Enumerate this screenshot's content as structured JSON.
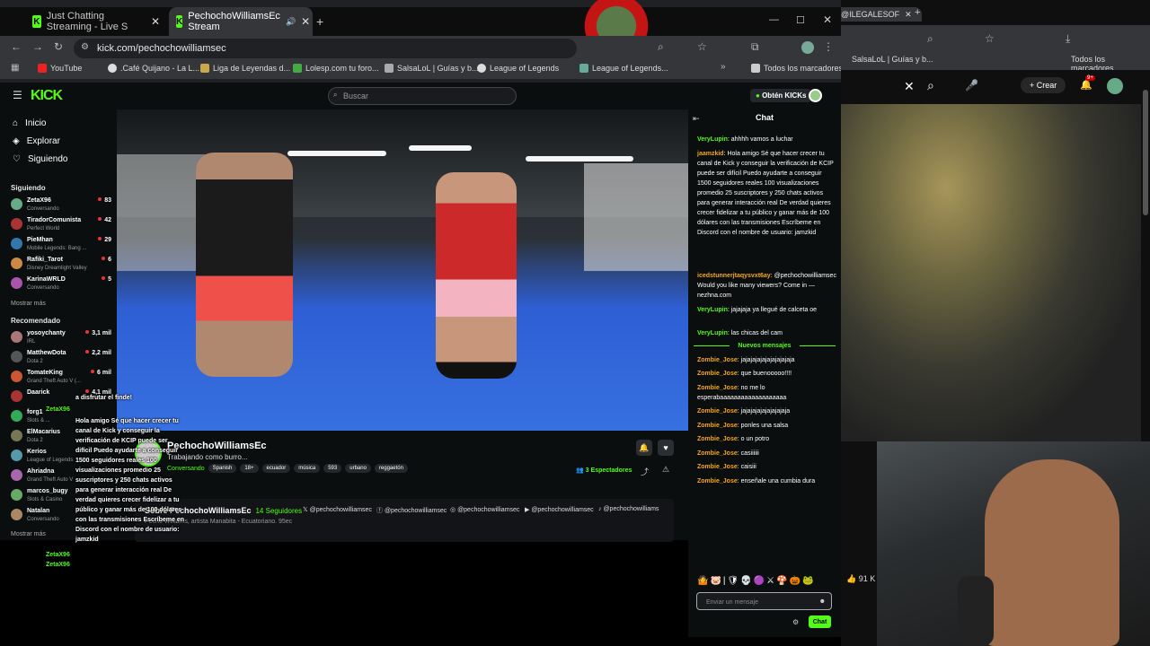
{
  "browser": {
    "tabs": [
      {
        "title": "Just Chatting Streaming - Live S"
      },
      {
        "title": "PechochoWilliamsEc Stream"
      }
    ],
    "url": "kick.com/pechochowilliamsec",
    "bookmarks": [
      "YouTube",
      ".Café Quijano - La L...",
      "Liga de Leyendas d...",
      "Lolesp.com tu foro...",
      "SalsaLoL | Guías y b...",
      "League of Legends",
      "League of Legends..."
    ],
    "all_bookmarks": "Todos los marcadores"
  },
  "header": {
    "logo": "KICK",
    "search_placeholder": "Buscar",
    "get_kicks": "Obtén KICKs"
  },
  "sidebar": {
    "nav": [
      {
        "label": "Inicio",
        "icon": "home-icon"
      },
      {
        "label": "Explorar",
        "icon": "compass-icon"
      },
      {
        "label": "Siguiendo",
        "icon": "heart-icon"
      }
    ],
    "following_title": "Siguiendo",
    "following": [
      {
        "name": "ZetaX96",
        "category": "Conversando",
        "viewers": "83",
        "color": "#6a8"
      },
      {
        "name": "TiradorComunista",
        "category": "Perfect World",
        "viewers": "42",
        "color": "#a33"
      },
      {
        "name": "PieMhan",
        "category": "Mobile Legends: Bang ...",
        "viewers": "29",
        "color": "#37a"
      },
      {
        "name": "Rafiki_Tarot",
        "category": "Disney Dreamlight Valley",
        "viewers": "6",
        "color": "#c84"
      },
      {
        "name": "KarinaWRLD",
        "category": "Conversando",
        "viewers": "5",
        "color": "#a5a"
      }
    ],
    "show_more": "Mostrar más",
    "recommended_title": "Recomendado",
    "recommended": [
      {
        "name": "yosoychanty",
        "category": "IRL",
        "viewers": "3,1 mil",
        "color": "#a77"
      },
      {
        "name": "MatthewDota",
        "category": "Dota 2",
        "viewers": "2,2 mil",
        "color": "#555"
      },
      {
        "name": "TomateKing",
        "category": "Grand Theft Auto V (...",
        "viewers": "6 mil",
        "color": "#c53"
      },
      {
        "name": "Daarick",
        "category": "",
        "viewers": "4,1 mil",
        "color": "#a33"
      },
      {
        "name": "forg1",
        "category": "Slots & ...",
        "viewers": "",
        "color": "#3a5"
      },
      {
        "name": "ElMacarius",
        "category": "Dota 2",
        "viewers": "",
        "color": "#775"
      },
      {
        "name": "Kerios",
        "category": "League of Legends",
        "viewers": "",
        "color": "#59a"
      },
      {
        "name": "Ahriadna",
        "category": "Grand Theft Auto V",
        "viewers": "",
        "color": "#a6a"
      },
      {
        "name": "marcos_bugy",
        "category": "Slots & Casino",
        "viewers": "",
        "color": "#6a6"
      },
      {
        "name": "Natalan",
        "category": "Conversando",
        "viewers": "",
        "color": "#a86"
      }
    ],
    "show_more2": "Mostrar más"
  },
  "stream": {
    "channel": "PechochoWilliamsEc",
    "title": "Trabajando como burro...",
    "category": "Conversando",
    "tags": [
      "Spanish",
      "18+",
      "ecuador",
      "música",
      "593",
      "urbano",
      "reggaetón"
    ],
    "viewers": "3",
    "viewers_label": "Espectadores",
    "about_title": "Sobre PechochoWilliamsEc",
    "followers": "14 Seguidores",
    "bio": "Pecho Williams, artista Manabita - Ecuatoriano. 95ec",
    "socials": [
      "@pechochowilliamsec",
      "@pechochowilliamsec",
      "@pechochowilliamsec",
      "@pechochowilliamsec",
      "@pechochowilliams"
    ]
  },
  "chat": {
    "title": "Chat",
    "messages": [
      {
        "user": "VeryLupin",
        "color": "#53fc18",
        "text": "ahhhh vamos a luchar"
      },
      {
        "user": "jaamzkid",
        "color": "#f5a623",
        "text": "Hola amigo Sé que hacer crecer tu canal de Kick y conseguir la verificación de KCIP puede ser difícil Puedo ayudarte a conseguir 1500 seguidores reales 100 visualizaciones promedio 25 suscriptores y 250 chats activos para generar interacción real De verdad quieres crecer fidelizar a tu público y ganar más de 100 dólares con las transmisiones Escríbeme en Discord con el nombre de usuario: jamzkid"
      },
      {
        "user": "icedstunnerjtaqysvxt6ay",
        "color": "#f5a623",
        "text": "@pechochowilliamsec Would you like many viewers? Come in — nezhna.com"
      },
      {
        "user": "VeryLupin",
        "color": "#53fc18",
        "text": "jajajaja ya llegué de calceta oe"
      },
      {
        "user": "VeryLupin",
        "color": "#53fc18",
        "text": "las chicas del cam"
      }
    ],
    "new_messages": "Nuevos mensajes",
    "new": [
      {
        "user": "Zombie_Jose",
        "color": "#f5a623",
        "text": "jajajajajajajajajajaja"
      },
      {
        "user": "Zombie_Jose",
        "color": "#f5a623",
        "text": "que buenooooo!!!!"
      },
      {
        "user": "Zombie_Jose",
        "color": "#f5a623",
        "text": "no me lo esperabaaaaaaaaaaaaaaaaaaa"
      },
      {
        "user": "Zombie_Jose",
        "color": "#f5a623",
        "text": "jajajajajajajajajaja"
      },
      {
        "user": "Zombie_Jose",
        "color": "#f5a623",
        "text": "ponles una salsa"
      },
      {
        "user": "Zombie_Jose",
        "color": "#f5a623",
        "text": "o un potro"
      },
      {
        "user": "Zombie_Jose",
        "color": "#f5a623",
        "text": "casiiiiii"
      },
      {
        "user": "Zombie_Jose",
        "color": "#f5a623",
        "text": "caisiii"
      },
      {
        "user": "Zombie_Jose",
        "color": "#f5a623",
        "text": "enseñale una cumbia dura"
      }
    ],
    "input_placeholder": "Enviar un mensaje",
    "send_label": "Chat"
  },
  "right": {
    "tab": "@ILEGALESOF",
    "bookmark": "SalsaLoL | Guías y b...",
    "all_bookmarks": "Todos los marcadores",
    "create": "Crear",
    "notif": "9+",
    "likes": "91 K"
  },
  "overlay": {
    "line1": "a disfrutar el finde!",
    "name1": "ZetaX96",
    "spam": "Hola amigo Sé que hacer crecer tu canal de Kick y conseguir la verificación de KCIP puede ser difícil Puedo ayudarte a conseguir 1500 seguidores reales 100 visualizaciones promedio 25 suscriptores y 250 chats activos para generar interacción real De verdad quieres crecer fidelizar a tu público y ganar más de 100 dólares con las transmisiones Escríbeme en Discord con el nombre de usuario: jamzkid",
    "name2": "ZetaX96",
    "name3": "ZetaX96"
  }
}
